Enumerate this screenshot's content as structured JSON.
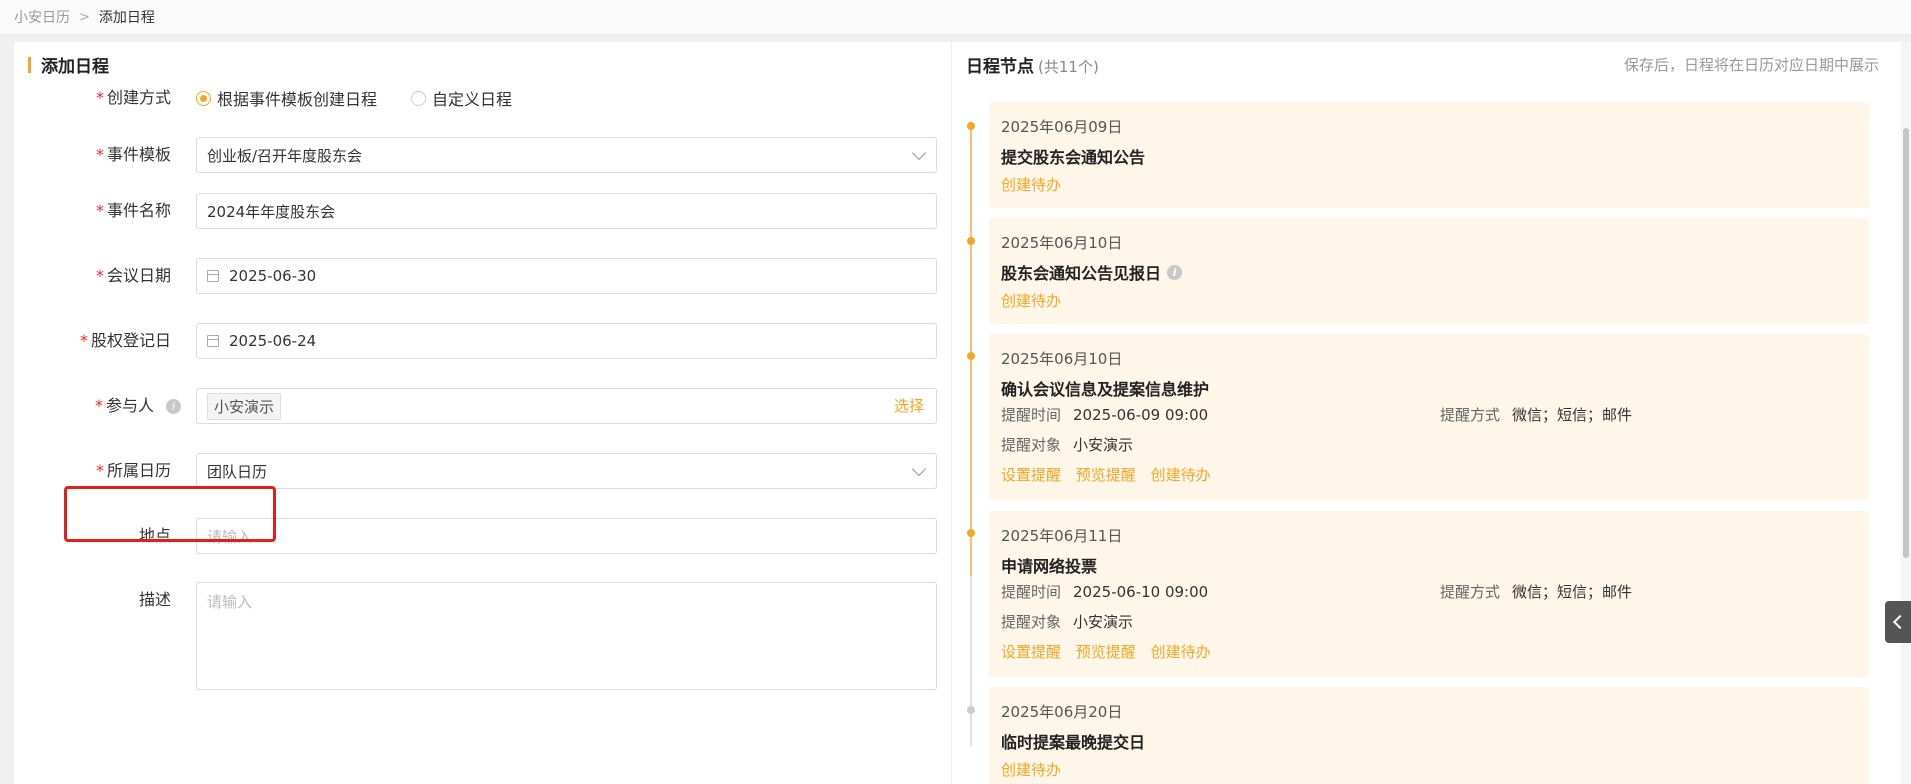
{
  "breadcrumb": {
    "parent": "小安日历",
    "current": "添加日程"
  },
  "left": {
    "title": "添加日程",
    "create_mode": {
      "label": "创建方式",
      "options": [
        "根据事件模板创建日程",
        "自定义日程"
      ],
      "selected": "根据事件模板创建日程"
    },
    "template": {
      "label": "事件模板",
      "value": "创业板/召开年度股东会"
    },
    "event_name": {
      "label": "事件名称",
      "value": "2024年年度股东会"
    },
    "meeting_date": {
      "label": "会议日期",
      "value": "2025-06-30"
    },
    "record_date": {
      "label": "股权登记日",
      "value": "2025-06-24"
    },
    "participants": {
      "label": "参与人",
      "tag": "小安演示",
      "select_label": "选择"
    },
    "calendar": {
      "label": "所属日历",
      "value": "团队日历"
    },
    "location": {
      "label": "地点",
      "placeholder": "请输入"
    },
    "description": {
      "label": "描述",
      "placeholder": "请输入"
    }
  },
  "right": {
    "title": "日程节点",
    "count": "(共11个)",
    "hint": "保存后，日程将在日历对应日期中展示",
    "cards": [
      {
        "date": "2025年06月09日",
        "title": "提交股东会通知公告",
        "links": [
          "创建待办"
        ]
      },
      {
        "date": "2025年06月10日",
        "title": "股东会通知公告见报日",
        "links": [
          "创建待办"
        ]
      },
      {
        "date": "2025年06月10日",
        "title": "确认会议信息及提案信息维护",
        "remind_time_label": "提醒时间",
        "remind_time": "2025-06-09 09:00",
        "remind_method_label": "提醒方式",
        "remind_method": "微信；短信；邮件",
        "remind_target_label": "提醒对象",
        "remind_target": "小安演示",
        "links": [
          "设置提醒",
          "预览提醒",
          "创建待办"
        ]
      },
      {
        "date": "2025年06月11日",
        "title": "申请网络投票",
        "remind_time_label": "提醒时间",
        "remind_time": "2025-06-10 09:00",
        "remind_method_label": "提醒方式",
        "remind_method": "微信；短信；邮件",
        "remind_target_label": "提醒对象",
        "remind_target": "小安演示",
        "links": [
          "设置提醒",
          "预览提醒",
          "创建待办"
        ]
      },
      {
        "date": "2025年06月20日",
        "title": "临时提案最晚提交日",
        "links": [
          "创建待办"
        ]
      }
    ]
  },
  "colors": {
    "accent": "#f5a623",
    "required": "#f5222d",
    "highlight": "#e0201c",
    "card_bg": "#fff6ea"
  }
}
